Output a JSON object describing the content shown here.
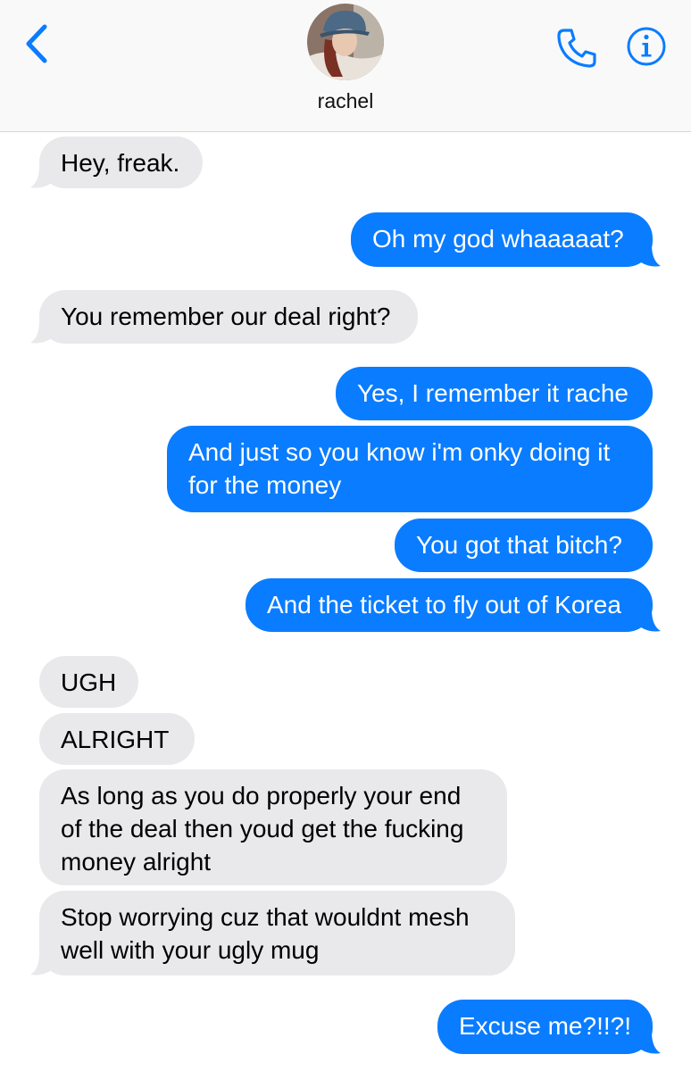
{
  "header": {
    "contact_name": "rachel",
    "back_icon": "chevron-left-icon",
    "call_icon": "phone-icon",
    "info_icon": "info-icon",
    "accent_color": "#0a7cff"
  },
  "messages": [
    {
      "direction": "incoming",
      "text": "Hey, freak."
    },
    {
      "direction": "outgoing",
      "text": "Oh my god whaaaaat?"
    },
    {
      "direction": "incoming",
      "text": "You remember our deal right?"
    },
    {
      "direction": "outgoing",
      "text": "Yes, I remember it rache"
    },
    {
      "direction": "outgoing",
      "text": "And just so you know i'm onky doing it for the money"
    },
    {
      "direction": "outgoing",
      "text": "You got that bitch?"
    },
    {
      "direction": "outgoing",
      "text": "And the ticket to fly out of Korea"
    },
    {
      "direction": "incoming",
      "text": "UGH"
    },
    {
      "direction": "incoming",
      "text": "ALRIGHT"
    },
    {
      "direction": "incoming",
      "text": "As long as you do properly your end of the deal then youd get the fucking money alright"
    },
    {
      "direction": "incoming",
      "text": "Stop worrying cuz that wouldnt mesh well with your ugly mug"
    },
    {
      "direction": "outgoing",
      "text": "Excuse me?!!?!"
    }
  ],
  "colors": {
    "incoming_bubble": "#e9e9eb",
    "outgoing_bubble": "#0a7cff"
  }
}
